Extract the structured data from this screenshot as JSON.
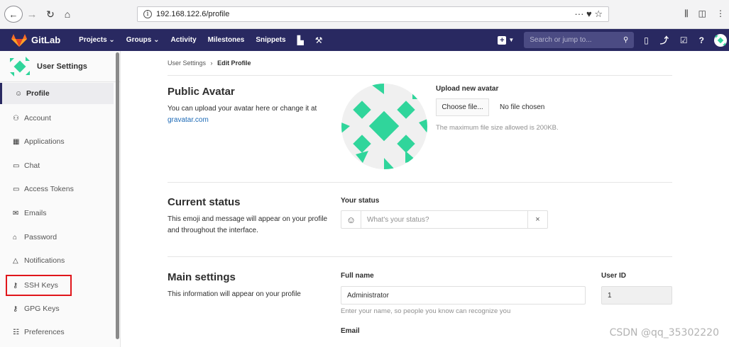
{
  "browser": {
    "url": "192.168.122.6/profile",
    "url_actions": "··· ♥ ☆"
  },
  "navbar": {
    "brand": "GitLab",
    "menu": [
      "Projects ⌄",
      "Groups ⌄",
      "Activity",
      "Milestones",
      "Snippets"
    ],
    "search_placeholder": "Search or jump to...",
    "accent_color": "#292961"
  },
  "sidebar": {
    "title": "User Settings",
    "items": [
      {
        "label": "Profile",
        "icon": "smile-icon"
      },
      {
        "label": "Account",
        "icon": "users-icon"
      },
      {
        "label": "Applications",
        "icon": "grid-icon"
      },
      {
        "label": "Chat",
        "icon": "chat-icon"
      },
      {
        "label": "Access Tokens",
        "icon": "key-card-icon"
      },
      {
        "label": "Emails",
        "icon": "mail-icon"
      },
      {
        "label": "Password",
        "icon": "lock-icon"
      },
      {
        "label": "Notifications",
        "icon": "bell-icon"
      },
      {
        "label": "SSH Keys",
        "icon": "key-icon"
      },
      {
        "label": "GPG Keys",
        "icon": "key-icon"
      },
      {
        "label": "Preferences",
        "icon": "sliders-icon"
      }
    ]
  },
  "breadcrumb": {
    "parent": "User Settings",
    "separator": "›",
    "current": "Edit Profile"
  },
  "avatar_section": {
    "title": "Public Avatar",
    "desc": "You can upload your avatar here or change it at",
    "link": "gravatar.com",
    "upload_label": "Upload new avatar",
    "choose_button": "Choose file...",
    "no_file": "No file chosen",
    "max_size_note": "The maximum file size allowed is 200KB."
  },
  "status_section": {
    "title": "Current status",
    "desc": "This emoji and message will appear on your profile and throughout the interface.",
    "label": "Your status",
    "placeholder": "What's your status?",
    "clear": "×"
  },
  "main_section": {
    "title": "Main settings",
    "desc": "This information will appear on your profile",
    "full_name_label": "Full name",
    "full_name_value": "Administrator",
    "full_name_help": "Enter your name, so people you know can recognize you",
    "user_id_label": "User ID",
    "user_id_value": "1",
    "email_label": "Email"
  },
  "watermark": "CSDN @qq_35302220"
}
